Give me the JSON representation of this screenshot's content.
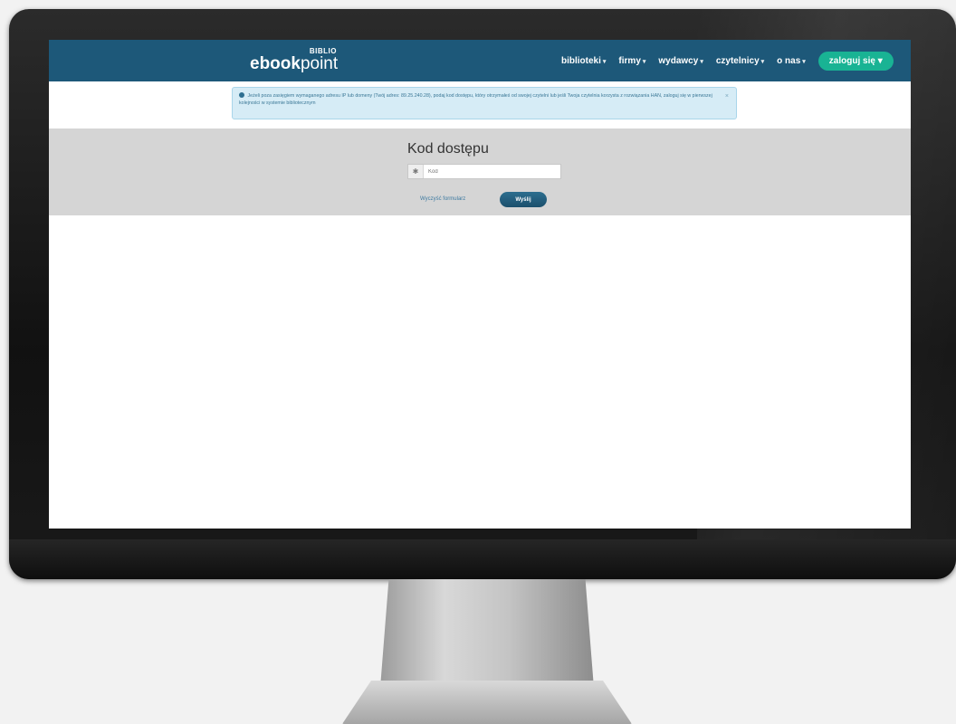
{
  "logo": {
    "top": "BIBLIO",
    "brand_bold": "ebook",
    "brand_light": "point"
  },
  "nav": {
    "items": [
      {
        "label": "biblioteki"
      },
      {
        "label": "firmy"
      },
      {
        "label": "wydawcy"
      },
      {
        "label": "czytelnicy"
      },
      {
        "label": "o nas"
      }
    ],
    "login_label": "zaloguj się",
    "caret": "▾"
  },
  "alert": {
    "text": "Jeżeli poza zasięgiem wymaganego adresu IP lub domeny (Twój adres: 89.25.240.28), podaj kod dostępu, który otrzymałeś od swojej czytelni lub jeśli Twoja czytelnia korzysta z rozwiązania HAN, zaloguj się w pierwszej kolejności w systemie bibliotecznym",
    "close": "×"
  },
  "access": {
    "title": "Kod dostępu",
    "input_placeholder": "Kod",
    "input_addon": "✱",
    "clear_label": "Wyczyść formularz",
    "submit_label": "Wyślij"
  }
}
